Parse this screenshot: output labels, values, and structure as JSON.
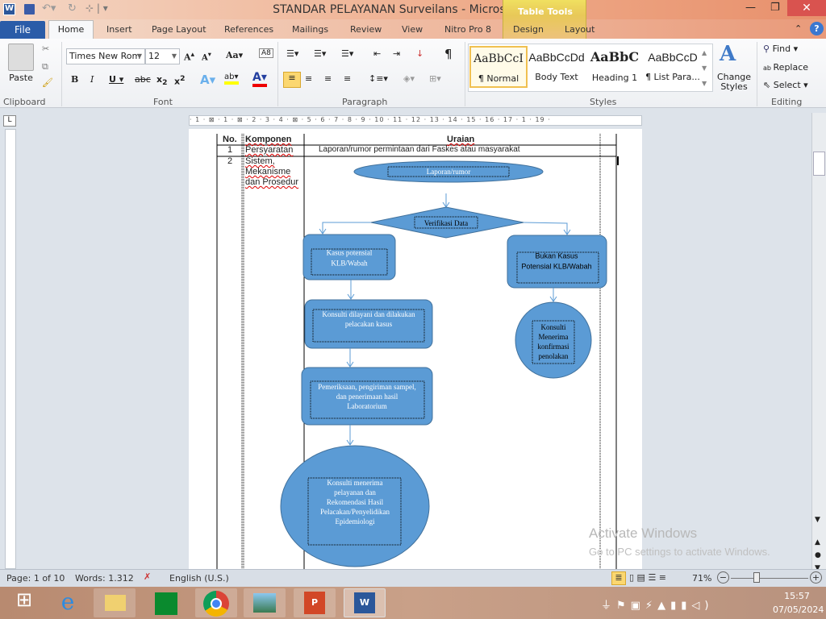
{
  "window": {
    "title": "STANDAR PELAYANAN Surveilans  -  Microsoft Word",
    "contextual": "Table Tools"
  },
  "tabs": [
    "File",
    "Home",
    "Insert",
    "Page Layout",
    "References",
    "Mailings",
    "Review",
    "View",
    "Nitro Pro 8",
    "Design",
    "Layout"
  ],
  "ribbon": {
    "clipboard": {
      "label": "Clipboard",
      "paste": "Paste"
    },
    "font": {
      "label": "Font",
      "name": "Times New Rom",
      "size": "12"
    },
    "paragraph": {
      "label": "Paragraph"
    },
    "styles": {
      "label": "Styles",
      "items": [
        {
          "sample": "AaBbCcI",
          "name": "¶ Normal"
        },
        {
          "sample": "AaBbCcDd",
          "name": "Body Text"
        },
        {
          "sample": "AaBbC",
          "name": "Heading 1"
        },
        {
          "sample": "AaBbCcD",
          "name": "¶ List Para..."
        }
      ],
      "change": "Change Styles"
    },
    "editing": {
      "label": "Editing",
      "find": "Find",
      "replace": "Replace",
      "select": "Select"
    }
  },
  "ruler": "· 1 · ⊠ · 1 · ⊠ · 2 · 3 · 4 · ⊠ · 5 · 6 · 7 · 8 · 9 · 10 · 11 · 12 · 13 · 14 · 15 · 16 · 17 · 1 · 19 ·",
  "table": {
    "headers": [
      "No.",
      "Komponen",
      "Uraian"
    ],
    "rows": [
      {
        "no": "1",
        "komponen": "Persyaratan",
        "uraian": "Laporan/rumor permintaan dari Faskes atau masyarakat"
      },
      {
        "no": "2",
        "komponen": "Sistem, Mekanisme dan Prosedur"
      }
    ]
  },
  "flowchart": {
    "start": "Laporan/rumor",
    "decision": "Verifikasi Data",
    "yes_box": [
      "Kasus potensial",
      "KLB/Wabah"
    ],
    "no_box": [
      "Bukan Kasus",
      "Potensial KLB/Wabah"
    ],
    "step2": [
      "Konsulti dilayani  dan dilakukan",
      "pelacakan  kasus"
    ],
    "no_end": [
      "Konsulti",
      "Menerima",
      "konfirmasi",
      "penolakan"
    ],
    "step3": [
      "Pemeriksaan,  pengiriman  sampel,",
      "dan penerimaan  hasil",
      "Laboratorium"
    ],
    "end": [
      "Konsulti menerima",
      "pelayanan  dan",
      "Rekomendasi  Hasil",
      "Pelacakan/Penyelidikan",
      "Epidemiologi"
    ],
    "fill": "#5b9bd5",
    "stroke": "#41719c"
  },
  "watermark": {
    "line1": "Activate Windows",
    "line2": "Go to PC settings to activate Windows."
  },
  "status": {
    "page": "Page: 1 of 10",
    "words": "Words: 1.312",
    "language": "English (U.S.)",
    "zoom": "71%",
    "zoom_value": 71
  },
  "clock": {
    "time": "15:57",
    "date": "07/05/2024"
  }
}
